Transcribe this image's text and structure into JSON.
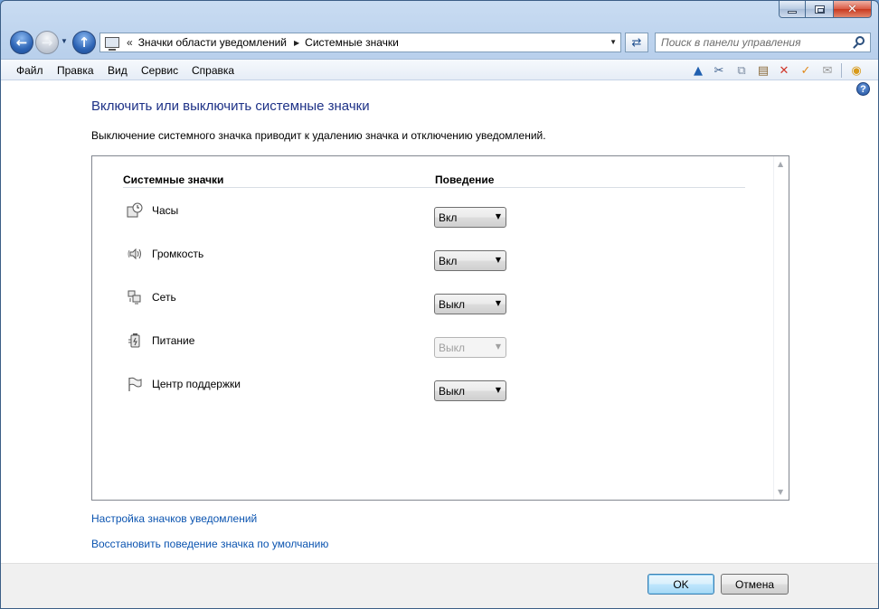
{
  "window": {
    "caption_buttons": {
      "minimize": "minimize-icon",
      "maximize": "maximize-icon",
      "close": "✕"
    }
  },
  "nav": {
    "address": {
      "chevron": "«",
      "crumbs": [
        "Значки области уведомлений",
        "Системные значки"
      ],
      "separator": "▶"
    },
    "search_placeholder": "Поиск в панели управления"
  },
  "menu": {
    "items": [
      {
        "label": "Файл"
      },
      {
        "label": "Правка"
      },
      {
        "label": "Вид"
      },
      {
        "label": "Сервис"
      },
      {
        "label": "Справка"
      }
    ]
  },
  "toolbar_icons": [
    "up-icon",
    "cut-icon",
    "copy-icon",
    "paste-icon",
    "delete-icon",
    "check-icon",
    "mail-icon",
    "globe-icon"
  ],
  "page": {
    "title": "Включить или выключить системные значки",
    "description": "Выключение системного значка приводит к удалению значка и отключению уведомлений.",
    "table": {
      "col_icons": "Системные значки",
      "col_behavior": "Поведение",
      "rows": [
        {
          "label": "Часы",
          "value": "Вкл",
          "icon": "clock-icon",
          "disabled": false
        },
        {
          "label": "Громкость",
          "value": "Вкл",
          "icon": "speaker-icon",
          "disabled": false
        },
        {
          "label": "Сеть",
          "value": "Выкл",
          "icon": "network-icon",
          "disabled": false
        },
        {
          "label": "Питание",
          "value": "Выкл",
          "icon": "power-icon",
          "disabled": true
        },
        {
          "label": "Центр поддержки",
          "value": "Выкл",
          "icon": "flag-icon",
          "disabled": false
        }
      ]
    },
    "links": {
      "notify_icons": "Настройка значков уведомлений",
      "restore_defaults": "Восстановить поведение значка по умолчанию"
    }
  },
  "footer": {
    "ok": "OK",
    "cancel": "Отмена"
  }
}
